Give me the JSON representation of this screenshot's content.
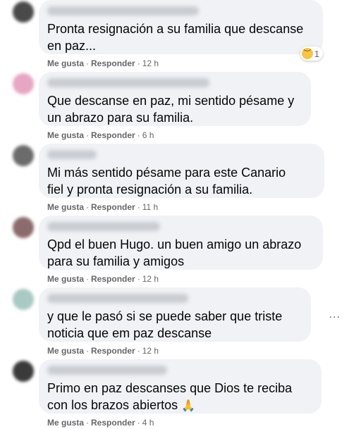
{
  "comments": [
    {
      "text": "Pronta resignación a su familia que descanse\nen paz...",
      "like": "Me gusta",
      "reply": "Responder",
      "time": "12 h",
      "reaction_count": "1",
      "avatar_color": "#4a4a4a"
    },
    {
      "text": "Que descanse en paz, mi sentido pésame y\nun abrazo para su familia.",
      "like": "Me gusta",
      "reply": "Responder",
      "time": "6 h",
      "avatar_color": "#e7a7c4"
    },
    {
      "text": "Mi más sentido pésame para este Canario\nfiel y pronta resignación a su familia.",
      "like": "Me gusta",
      "reply": "Responder",
      "time": "11 h",
      "avatar_color": "#6b6b6b"
    },
    {
      "text": "Qpd el buen Hugo. un buen amigo un abrazo\npara su familia y amigos",
      "like": "Me gusta",
      "reply": "Responder",
      "time": "12 h",
      "avatar_color": "#8b6b6b"
    },
    {
      "text": "y que le pasó si se puede saber que triste\nnoticia que em paz descanse",
      "like": "Me gusta",
      "reply": "Responder",
      "time": "12 h",
      "avatar_color": "#a9c9c4"
    },
    {
      "text": "Primo en paz descanses que Dios te reciba\ncon los brazos abiertos",
      "like": "Me gusta",
      "reply": "Responder",
      "time": "4 h",
      "avatar_color": "#3a3a3a"
    }
  ],
  "more_options": "...",
  "reaction_icon": "sad-face",
  "emoji_icon": "folded-hands"
}
